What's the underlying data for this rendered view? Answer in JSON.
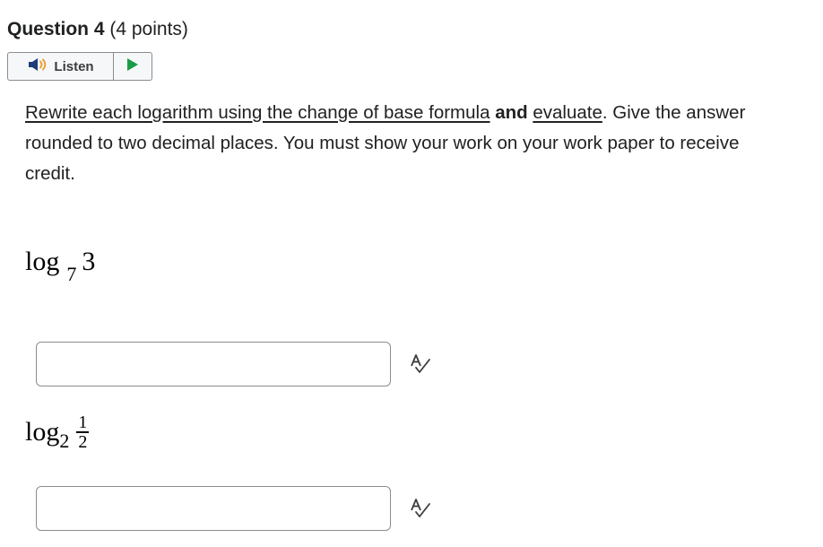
{
  "question": {
    "title": "Question 4",
    "points": "(4 points)"
  },
  "listen": {
    "label": "Listen",
    "speaker_icon": "speaker-icon",
    "play_icon": "play-icon"
  },
  "instructions": {
    "part1": "Rewrite each logarithm using the change of base formula",
    "and": "and",
    "part2": "evaluate",
    "rest": ". Give the answer rounded to two decimal places. You must show your work on your work paper to receive credit."
  },
  "problems": [
    {
      "log": "log",
      "base": "7",
      "argument": "3",
      "answer_value": ""
    },
    {
      "log": "log",
      "base": "2",
      "numerator": "1",
      "denominator": "2",
      "answer_value": ""
    }
  ],
  "icons": {
    "spellcheck": "spellcheck-icon"
  },
  "colors": {
    "play_green": "#1a9b4a",
    "speaker_blue": "#1f3d7a",
    "border": "#8a8c8f"
  }
}
